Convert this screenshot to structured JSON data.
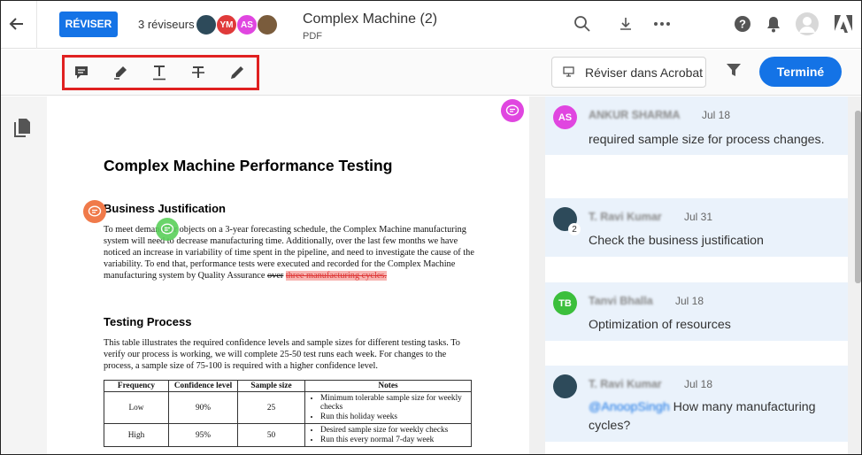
{
  "header": {
    "review_button": "RÉVISER",
    "reviewers_label": "3 réviseurs",
    "avatars": [
      {
        "initials": "",
        "color": "#2d4a5a"
      },
      {
        "initials": "YM",
        "color": "#e03a3a"
      },
      {
        "initials": "AS",
        "color": "#e046e0"
      },
      {
        "initials": "",
        "color": "#7a5c3c"
      }
    ],
    "doc_title": "Complex Machine (2)",
    "doc_type": "PDF"
  },
  "toolbar": {
    "acrobat_button": "Réviser dans Acrobat",
    "done_button": "Terminé"
  },
  "document": {
    "title": "Complex Machine Performance Testing",
    "section1_heading": "Business Justification",
    "section1_text_a": "To meet demand for objects on a 3-year forecasting schedule, the Complex Machine manufacturing system will need to decrease manufacturing time. Additionally, over the last few months we have noticed an increase in variability of time spent in the pipeline, and need to investigate the cause of the variability. To end that, performance tests were executed and recorded for the Complex Machine manufacturing system by Quality Assurance ",
    "section1_strike": "over",
    "section1_strike_red": "three manufacturing cycles.",
    "section2_heading": "Testing Process",
    "section2_text": "This table illustrates the required confidence levels and sample sizes for different testing tasks. To verify our process is working, we will complete 25-50 test runs each week. For changes to the process, a sample size of 75-100 is required with a higher confidence level.",
    "table": {
      "headers": [
        "Frequency",
        "Confidence level",
        "Sample size",
        "Notes"
      ],
      "rows": [
        {
          "frequency": "Low",
          "confidence": "90%",
          "sample": "25",
          "notes": [
            "Minimum tolerable sample size for weekly checks",
            "Run this holiday weeks"
          ]
        },
        {
          "frequency": "High",
          "confidence": "95%",
          "sample": "50",
          "notes": [
            "Desired sample size for weekly checks",
            "Run this every normal 7-day week"
          ]
        }
      ]
    }
  },
  "comments": [
    {
      "initials": "AS",
      "color": "#e046e0",
      "author": "ANKUR SHARMA",
      "date": "Jul 18",
      "text": "required sample size for process changes.",
      "mention": ""
    },
    {
      "initials": "",
      "color": "#2d4a5a",
      "author": "T. Ravi Kumar",
      "date": "Jul 31",
      "text": "Check the business justification",
      "mention": "",
      "replies": "2"
    },
    {
      "initials": "TB",
      "color": "#3cbf3c",
      "author": "Tanvi Bhalla",
      "date": "Jul 18",
      "text": "Optimization of resources",
      "mention": ""
    },
    {
      "initials": "",
      "color": "#2d4a5a",
      "author": "T. Ravi Kumar",
      "date": "Jul 18",
      "text": " How many manufacturing cycles?",
      "mention": "@AnoopSingh"
    }
  ],
  "colors": {
    "accent": "#1473e6",
    "highlight_box": "#e02020"
  }
}
